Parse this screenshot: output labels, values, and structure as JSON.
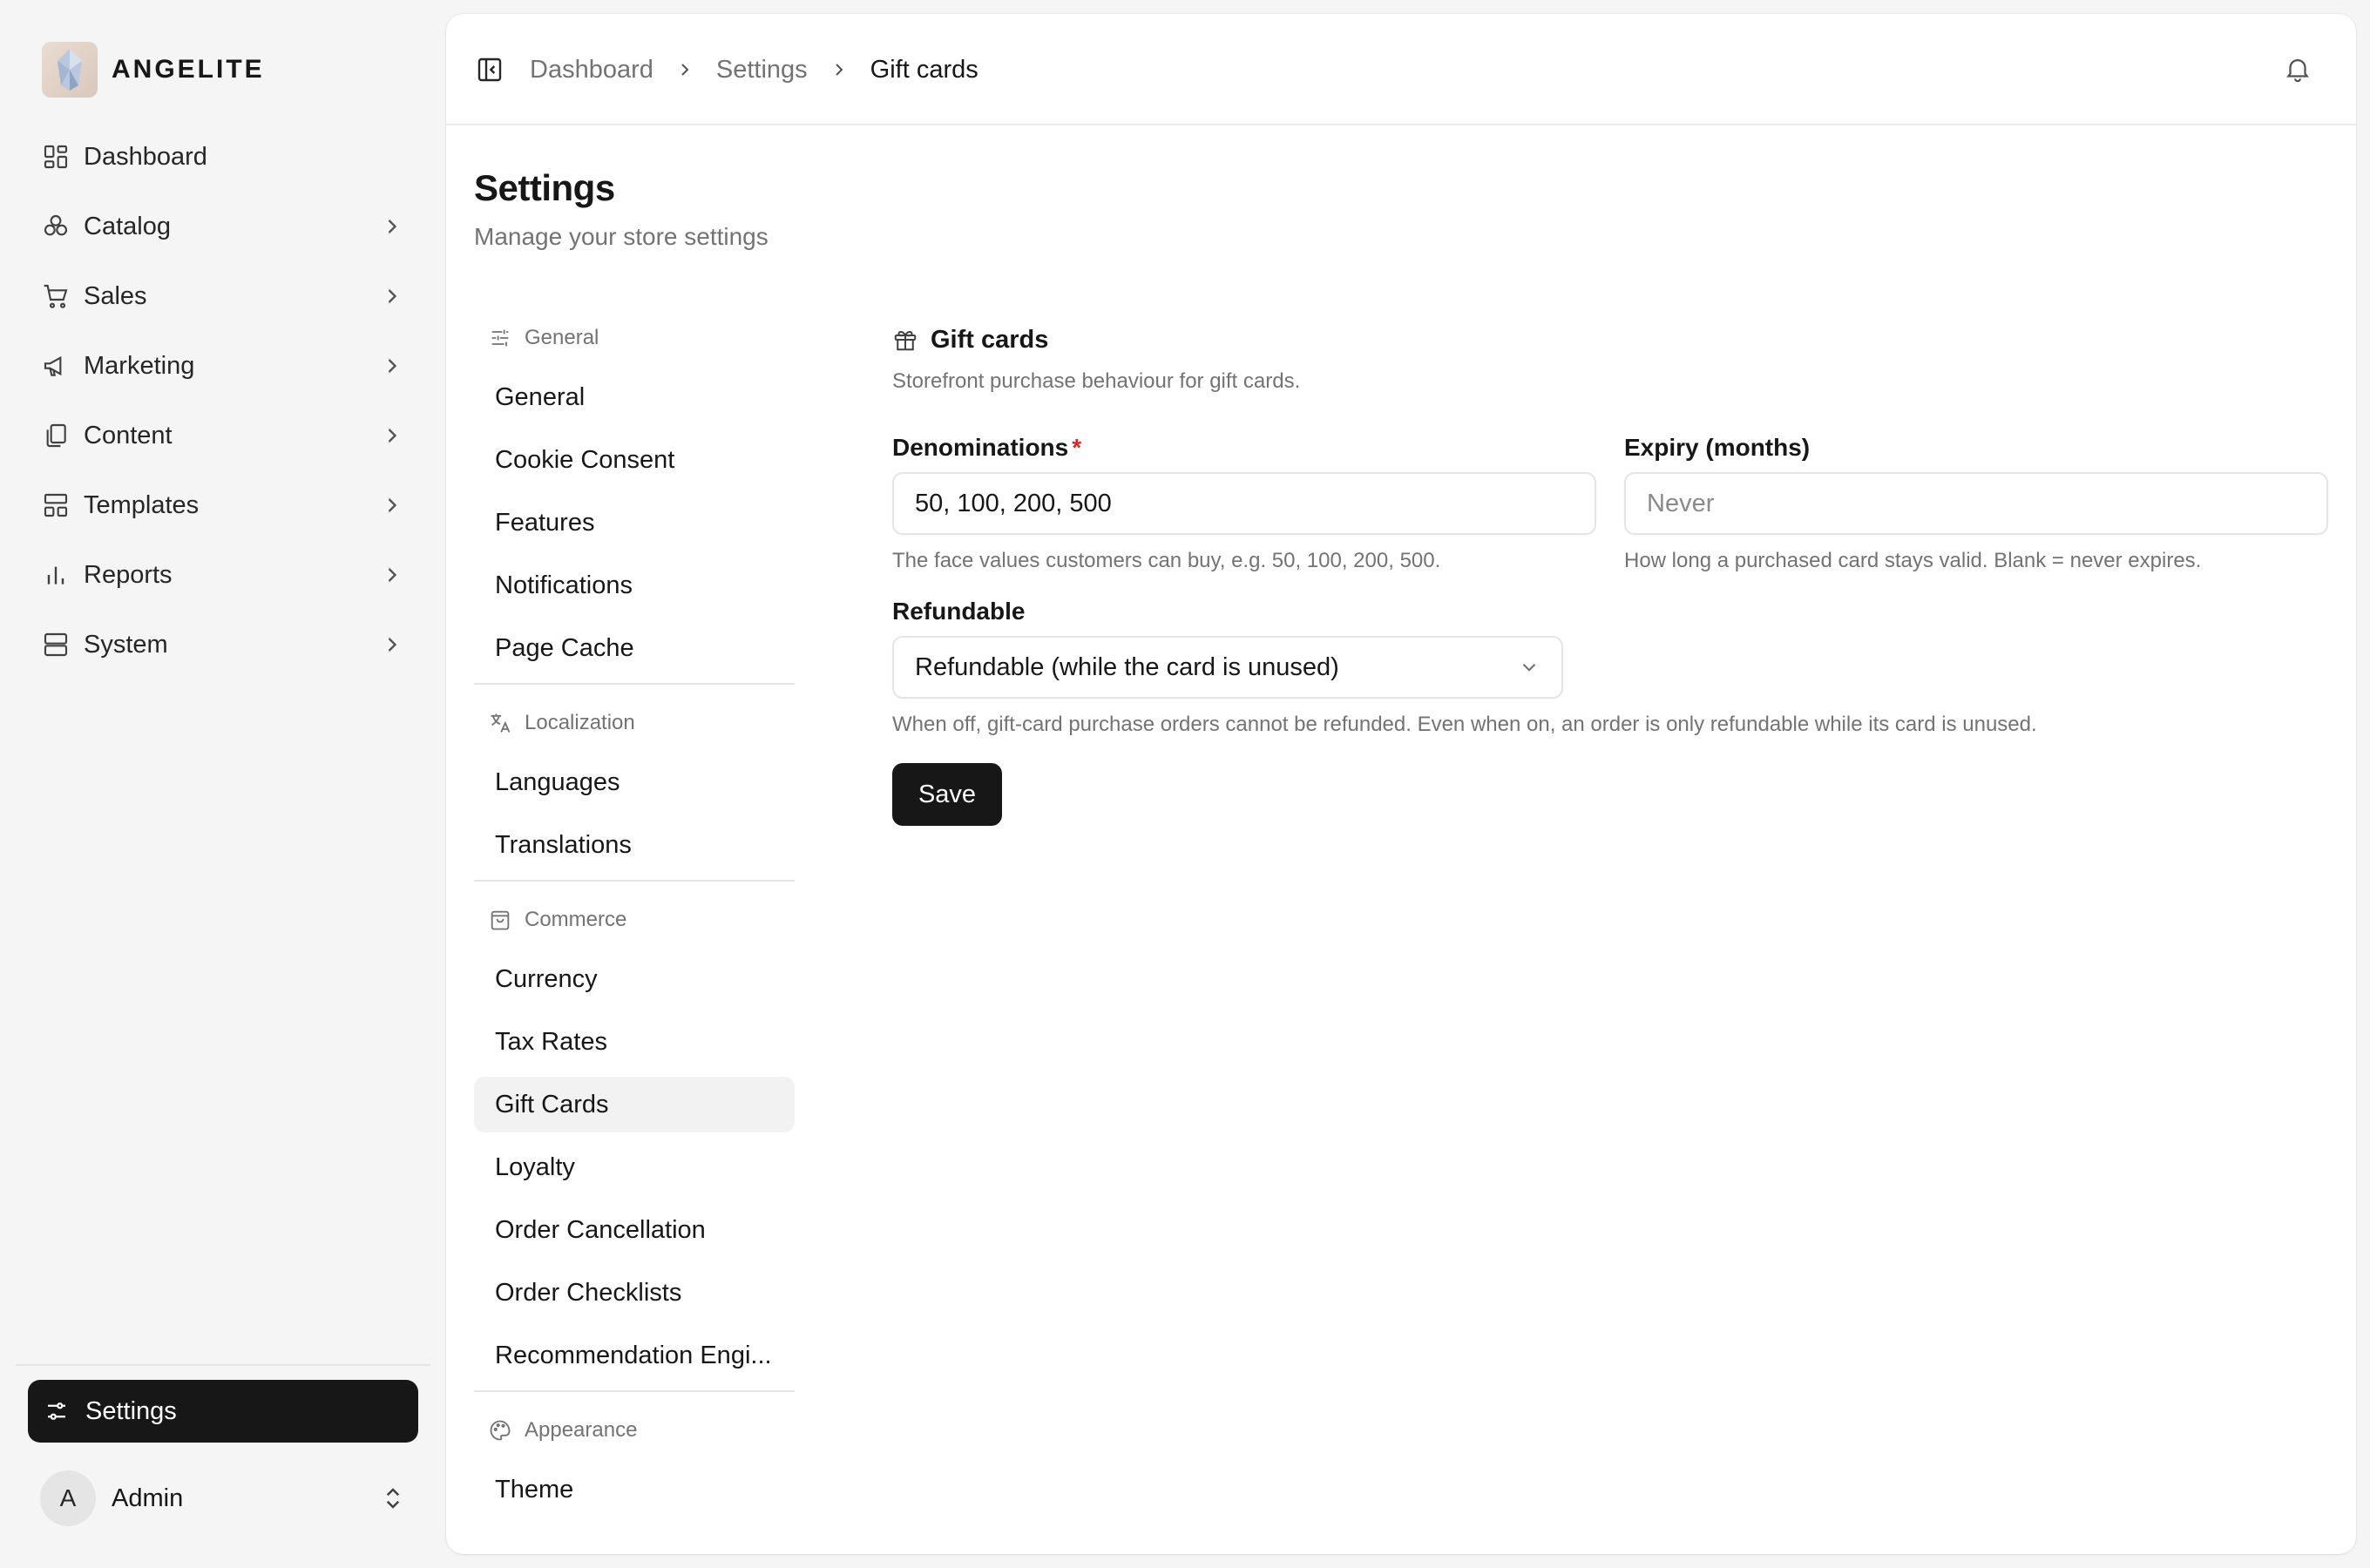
{
  "brand": {
    "name": "ANGELITE"
  },
  "sidebar": {
    "items": [
      {
        "label": "Dashboard",
        "icon": "dashboard-icon"
      },
      {
        "label": "Catalog",
        "icon": "catalog-icon"
      },
      {
        "label": "Sales",
        "icon": "cart-icon"
      },
      {
        "label": "Marketing",
        "icon": "megaphone-icon"
      },
      {
        "label": "Content",
        "icon": "copy-icon"
      },
      {
        "label": "Templates",
        "icon": "layout-icon"
      },
      {
        "label": "Reports",
        "icon": "bar-chart-icon"
      },
      {
        "label": "System",
        "icon": "server-icon"
      }
    ],
    "settings_label": "Settings",
    "user": {
      "initial": "A",
      "name": "Admin"
    }
  },
  "breadcrumb": [
    "Dashboard",
    "Settings",
    "Gift cards"
  ],
  "page": {
    "title": "Settings",
    "subtitle": "Manage your store settings"
  },
  "settings_nav": {
    "groups": [
      {
        "label": "General",
        "icon": "sliders-icon",
        "items": [
          "General",
          "Cookie Consent",
          "Features",
          "Notifications",
          "Page Cache"
        ]
      },
      {
        "label": "Localization",
        "icon": "translate-icon",
        "items": [
          "Languages",
          "Translations"
        ]
      },
      {
        "label": "Commerce",
        "icon": "shopping-bag-icon",
        "items": [
          "Currency",
          "Tax Rates",
          "Gift Cards",
          "Loyalty",
          "Order Cancellation",
          "Order Checklists",
          "Recommendation Engi..."
        ]
      },
      {
        "label": "Appearance",
        "icon": "palette-icon",
        "items": [
          "Theme"
        ]
      }
    ],
    "active": "Gift Cards"
  },
  "form": {
    "section_title": "Gift cards",
    "section_desc": "Storefront purchase behaviour for gift cards.",
    "denominations": {
      "label": "Denominations",
      "required_mark": "*",
      "value": "50, 100, 200, 500",
      "help": "The face values customers can buy, e.g. 50, 100, 200, 500."
    },
    "expiry": {
      "label": "Expiry (months)",
      "placeholder": "Never",
      "value": "",
      "help": "How long a purchased card stays valid. Blank = never expires."
    },
    "refundable": {
      "label": "Refundable",
      "selected": "Refundable (while the card is unused)",
      "help": "When off, gift-card purchase orders cannot be refunded. Even when on, an order is only refundable while its card is unused."
    },
    "save_label": "Save"
  },
  "colors": {
    "primary": "#171717",
    "page_bg": "#f5f5f5",
    "required": "#dc2626",
    "muted_text": "#737373"
  }
}
